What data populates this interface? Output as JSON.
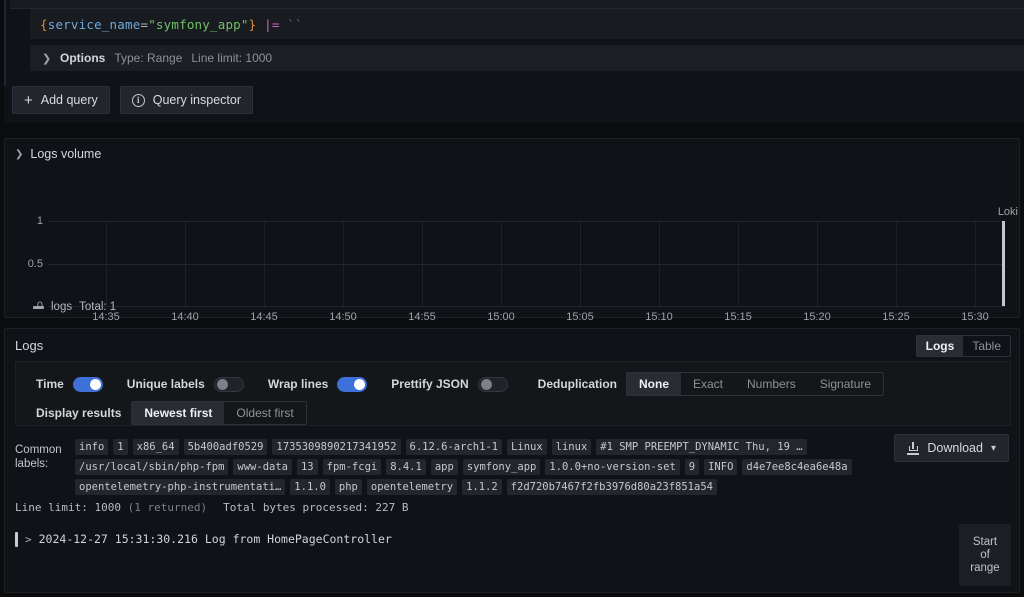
{
  "query_editor": {
    "expression": {
      "open_brace": "{",
      "label": "service_name",
      "equals": "=",
      "value": "\"symfony_app\"",
      "close_brace": "}",
      "operator": "|=",
      "empty_string": "``"
    },
    "options": {
      "toggle_label": "Options",
      "type": "Type: Range",
      "line_limit": "Line limit: 1000"
    },
    "add_query_label": "Add query",
    "query_inspector_label": "Query inspector"
  },
  "logs_volume": {
    "title": "Logs volume",
    "legend": {
      "name": "logs",
      "total": "Total: 1"
    }
  },
  "chart_data": {
    "type": "bar",
    "title": "Logs volume",
    "xlabel": "",
    "ylabel": "",
    "ylim": [
      0,
      1
    ],
    "yticks": [
      "0",
      "0.5",
      "1"
    ],
    "xticks": [
      "14:35",
      "14:40",
      "14:45",
      "14:50",
      "14:55",
      "15:00",
      "15:05",
      "15:10",
      "15:15",
      "15:20",
      "15:25",
      "15:30"
    ],
    "grid": true,
    "legend_position": "bottom-left",
    "annotation": "Loki",
    "series": [
      {
        "name": "logs",
        "color": "#c6c8cc",
        "total": 1,
        "points": [
          {
            "x": "15:31:30",
            "y": 1
          }
        ]
      }
    ]
  },
  "logs_panel": {
    "title": "Logs",
    "view_modes": [
      {
        "label": "Logs",
        "selected": true
      },
      {
        "label": "Table",
        "selected": false
      }
    ],
    "toggles": [
      {
        "label": "Time",
        "state": "on"
      },
      {
        "label": "Unique labels",
        "state": "off"
      },
      {
        "label": "Wrap lines",
        "state": "on"
      },
      {
        "label": "Prettify JSON",
        "state": "off"
      }
    ],
    "deduplication": {
      "label": "Deduplication",
      "options": [
        {
          "label": "None",
          "selected": true
        },
        {
          "label": "Exact",
          "selected": false
        },
        {
          "label": "Numbers",
          "selected": false
        },
        {
          "label": "Signature",
          "selected": false
        }
      ]
    },
    "display_results": {
      "label": "Display results",
      "options": [
        {
          "label": "Newest first",
          "selected": true
        },
        {
          "label": "Oldest first",
          "selected": false
        }
      ]
    },
    "common_labels": {
      "label_line1": "Common",
      "label_line2": "labels:",
      "chips": [
        "info",
        "1",
        "x86_64",
        "5b400adf0529",
        "1735309890217341952",
        "6.12.6-arch1-1",
        "Linux",
        "linux",
        "#1 SMP PREEMPT_DYNAMIC Thu, 19 …",
        "/usr/local/sbin/php-fpm",
        "www-data",
        "13",
        "fpm-fcgi",
        "8.4.1",
        "app",
        "symfony_app",
        "1.0.0+no-version-set",
        "9",
        "INFO",
        "d4e7ee8c4ea6e48a",
        "opentelemetry-php-instrumentati…",
        "1.1.0",
        "php",
        "opentelemetry",
        "1.1.2",
        "f2d720b7467f2fb3976d80a23f851a54"
      ]
    },
    "download_label": "Download",
    "meta": {
      "line_limit": "Line limit: 1000",
      "returned": "(1 returned)",
      "bytes": "Total bytes processed: 227 B"
    },
    "log_rows": [
      {
        "timestamp": "2024-12-27 15:31:30.216",
        "message": "Log from HomePageController"
      }
    ],
    "start_of_range": {
      "line1": "Start",
      "line2": "of",
      "line3": "range"
    }
  },
  "colors": {
    "accent": "#3d71d9",
    "panel_bg": "#111217",
    "page_bg": "#0b0c0e",
    "bar": "#c6c8cc"
  }
}
